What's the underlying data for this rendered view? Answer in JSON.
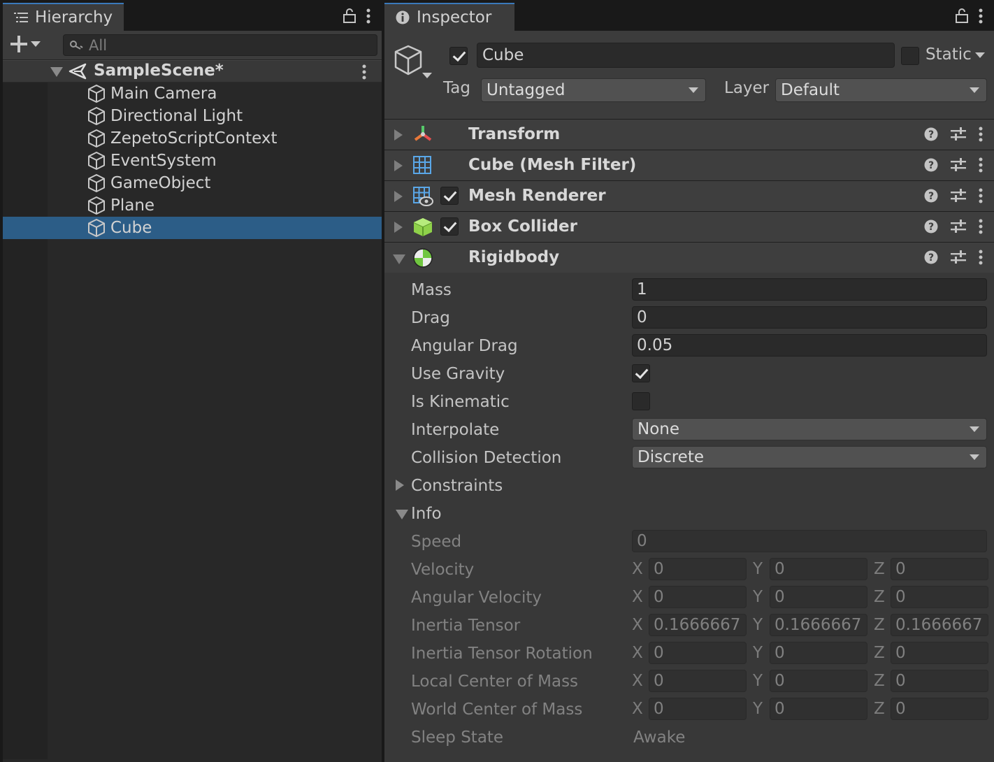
{
  "hierarchy": {
    "tab_title": "Hierarchy",
    "search_placeholder": "All",
    "scene": "SampleScene*",
    "items": [
      {
        "label": "Main Camera"
      },
      {
        "label": "Directional Light"
      },
      {
        "label": "ZepetoScriptContext"
      },
      {
        "label": "EventSystem"
      },
      {
        "label": "GameObject"
      },
      {
        "label": "Plane"
      },
      {
        "label": "Cube",
        "selected": true
      }
    ]
  },
  "inspector": {
    "tab_title": "Inspector",
    "object_name": "Cube",
    "active": true,
    "static_label": "Static",
    "static": false,
    "tag_label": "Tag",
    "tag_value": "Untagged",
    "layer_label": "Layer",
    "layer_value": "Default",
    "components": [
      {
        "name": "Transform",
        "icon": "transform-icon",
        "has_toggle": false
      },
      {
        "name": "Cube (Mesh Filter)",
        "icon": "mesh-filter-icon",
        "has_toggle": false
      },
      {
        "name": "Mesh Renderer",
        "icon": "mesh-renderer-icon",
        "has_toggle": true,
        "enabled": true
      },
      {
        "name": "Box Collider",
        "icon": "box-collider-icon",
        "has_toggle": true,
        "enabled": true
      },
      {
        "name": "Rigidbody",
        "icon": "rigidbody-icon",
        "has_toggle": false,
        "expanded": true
      }
    ],
    "rigidbody": {
      "mass_label": "Mass",
      "mass": "1",
      "drag_label": "Drag",
      "drag": "0",
      "angular_drag_label": "Angular Drag",
      "angular_drag": "0.05",
      "use_gravity_label": "Use Gravity",
      "use_gravity": true,
      "is_kinematic_label": "Is Kinematic",
      "is_kinematic": false,
      "interpolate_label": "Interpolate",
      "interpolate": "None",
      "collision_label": "Collision Detection",
      "collision": "Discrete",
      "constraints_label": "Constraints",
      "info_label": "Info",
      "info": {
        "speed_label": "Speed",
        "speed": "0",
        "sleep_label": "Sleep State",
        "sleep": "Awake",
        "vectors": [
          {
            "label": "Velocity",
            "x": "0",
            "y": "0",
            "z": "0"
          },
          {
            "label": "Angular Velocity",
            "x": "0",
            "y": "0",
            "z": "0"
          },
          {
            "label": "Inertia Tensor",
            "x": "0.1666667",
            "y": "0.1666667",
            "z": "0.1666667"
          },
          {
            "label": "Inertia Tensor Rotation",
            "x": "0",
            "y": "0",
            "z": "0"
          },
          {
            "label": "Local Center of Mass",
            "x": "0",
            "y": "0",
            "z": "0"
          },
          {
            "label": "World Center of Mass",
            "x": "0",
            "y": "0",
            "z": "0"
          }
        ]
      }
    },
    "axis_labels": {
      "x": "X",
      "y": "Y",
      "z": "Z"
    }
  },
  "colors": {
    "selection": "#2c5d87",
    "panel": "#383838",
    "accent_tab": "#3a79bb",
    "collider_green": "#8fd14a"
  }
}
